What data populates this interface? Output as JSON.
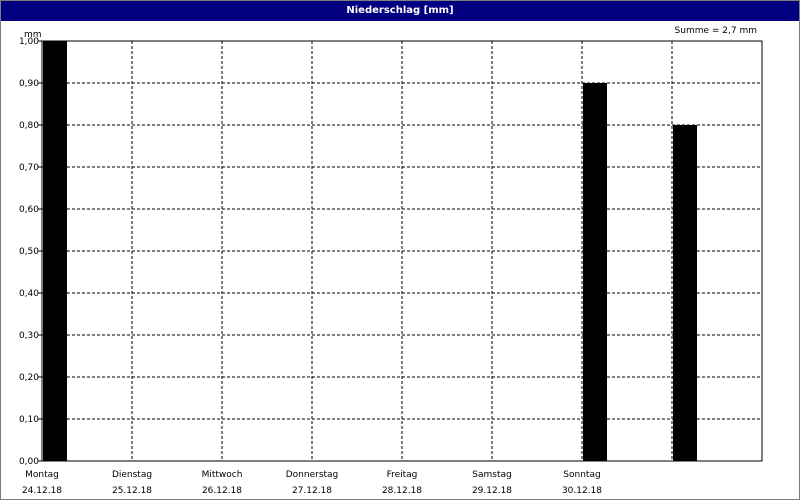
{
  "window": {
    "title": "Niederschlag [mm]"
  },
  "chart_data": {
    "type": "bar",
    "unit_label": "mm",
    "summary": "Summe = 2,7 mm",
    "categories": [
      {
        "day": "Montag",
        "date": "24.12.18"
      },
      {
        "day": "Dienstag",
        "date": "25.12.18"
      },
      {
        "day": "Mittwoch",
        "date": "26.12.18"
      },
      {
        "day": "Donnerstag",
        "date": "27.12.18"
      },
      {
        "day": "Freitag",
        "date": "28.12.18"
      },
      {
        "day": "Samstag",
        "date": "29.12.18"
      },
      {
        "day": "Sonntag",
        "date": "30.12.18"
      }
    ],
    "values": [
      1.0,
      0,
      0,
      0,
      0,
      0,
      0.9,
      0.8
    ],
    "y_ticks": [
      "0,00",
      "0,10",
      "0,20",
      "0,30",
      "0,40",
      "0,50",
      "0,60",
      "0,70",
      "0,80",
      "0,90",
      "1,00"
    ],
    "ylim": [
      0,
      1.0
    ],
    "grid": true,
    "bar_color": "#000000",
    "grid_color": "#000000",
    "title_bar_color": "#000080"
  }
}
